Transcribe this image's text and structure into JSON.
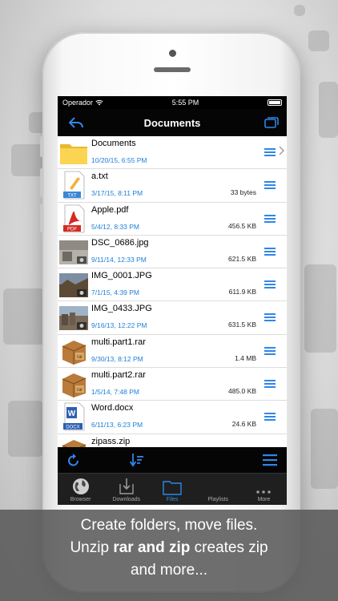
{
  "status_bar": {
    "carrier": "Operador",
    "time": "5:55 PM"
  },
  "nav": {
    "title": "Documents"
  },
  "files": [
    {
      "name": "Documents",
      "date": "10/20/15, 6:55 PM",
      "size": "",
      "type": "folder"
    },
    {
      "name": "a.txt",
      "date": "3/17/15, 8:11 PM",
      "size": "33 bytes",
      "type": "txt"
    },
    {
      "name": "Apple.pdf",
      "date": "5/4/12, 8:33 PM",
      "size": "456.5 KB",
      "type": "pdf"
    },
    {
      "name": "DSC_0686.jpg",
      "date": "9/11/14, 12:33 PM",
      "size": "621.5 KB",
      "type": "image"
    },
    {
      "name": "IMG_0001.JPG",
      "date": "7/1/15, 4:39 PM",
      "size": "611.9 KB",
      "type": "image"
    },
    {
      "name": "IMG_0433.JPG",
      "date": "9/16/13, 12:22 PM",
      "size": "631.5 KB",
      "type": "image"
    },
    {
      "name": "multi.part1.rar",
      "date": "9/30/13, 8:12 PM",
      "size": "1.4 MB",
      "type": "rar"
    },
    {
      "name": "multi.part2.rar",
      "date": "1/5/14, 7:48 PM",
      "size": "485.0 KB",
      "type": "rar"
    },
    {
      "name": "Word.docx",
      "date": "6/11/13, 6:23 PM",
      "size": "24.6 KB",
      "type": "docx"
    },
    {
      "name": "zipass.zip",
      "date": "",
      "size": "",
      "type": "zip"
    }
  ],
  "file_icon_text": {
    "txt": "TXT",
    "pdf": "PDF",
    "rar": "rar",
    "docx": "DOCX"
  },
  "tabs": [
    {
      "label": "Browser",
      "icon": "globe-icon",
      "active": false
    },
    {
      "label": "Downloads",
      "icon": "download-icon",
      "active": false
    },
    {
      "label": "Files",
      "icon": "folder-icon",
      "active": true
    },
    {
      "label": "Playlists",
      "icon": "playlist-icon",
      "active": false
    },
    {
      "label": "More",
      "icon": "more-icon",
      "active": false
    }
  ],
  "caption": {
    "line1": "Create folders, move files.",
    "line2_pre": "Unzip ",
    "line2_bold": "rar and zip",
    "line2_post": " creates zip",
    "line3": "and more..."
  },
  "colors": {
    "accent": "#1e7fd6",
    "date_text": "#1e7fd6",
    "bar_bg": "#050505"
  }
}
